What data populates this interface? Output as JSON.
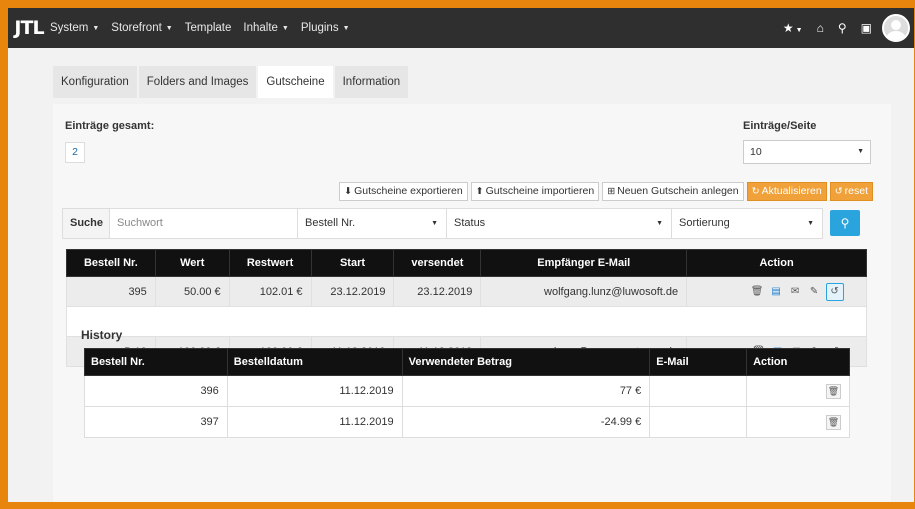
{
  "topbar": {
    "logo": "JTL",
    "nav": [
      "System",
      "Storefront",
      "Template",
      "Inhalte",
      "Plugins"
    ],
    "nav_has_caret": [
      true,
      true,
      false,
      true,
      true
    ],
    "icons": [
      "star-icon",
      "home-icon",
      "search-icon",
      "shop-icon"
    ]
  },
  "tabs": [
    "Konfiguration",
    "Folders and Images",
    "Gutscheine",
    "Information"
  ],
  "active_tab": "Gutscheine",
  "summary": {
    "total_label": "Einträge gesamt:",
    "total_value": "2",
    "perpage_label": "Einträge/Seite",
    "perpage_value": "10"
  },
  "buttons": {
    "export": "Gutscheine exportieren",
    "import": "Gutscheine importieren",
    "new": "Neuen Gutschein anlegen",
    "refresh": "Aktualisieren",
    "reset": "reset"
  },
  "search": {
    "label": "Suche",
    "placeholder": "Suchwort",
    "order_select": "Bestell Nr.",
    "status_select": "Status",
    "sort_select": "Sortierung"
  },
  "main_table": {
    "headers": [
      "Bestell Nr.",
      "Wert",
      "Restwert",
      "Start",
      "versendet",
      "Empfänger E-Mail",
      "Action"
    ],
    "rows": [
      {
        "order": "395",
        "value": "50.00 €",
        "rest": "102.01 €",
        "start": "23.12.2019",
        "sent": "23.12.2019",
        "email": "wolfgang.lunz@luwosoft.de"
      },
      {
        "order": "B.10",
        "value": "100.00 €",
        "rest": "100.00 €",
        "start": "11.12.2019",
        "sent": "11.12.2019",
        "email": "hans@css-umsetzung.de"
      }
    ]
  },
  "history": {
    "title": "History",
    "headers": [
      "Bestell Nr.",
      "Bestelldatum",
      "Verwendeter Betrag",
      "E-Mail",
      "Action"
    ],
    "rows": [
      {
        "order": "396",
        "date": "11.12.2019",
        "amount": "77 €",
        "email": ""
      },
      {
        "order": "397",
        "date": "11.12.2019",
        "amount": "-24.99 €",
        "email": ""
      }
    ]
  },
  "colors": {
    "border_accent": "#e8850c",
    "topbar": "#2f2f2f",
    "primary": "#2aa4dd",
    "orange_button": "#f0a13a"
  }
}
